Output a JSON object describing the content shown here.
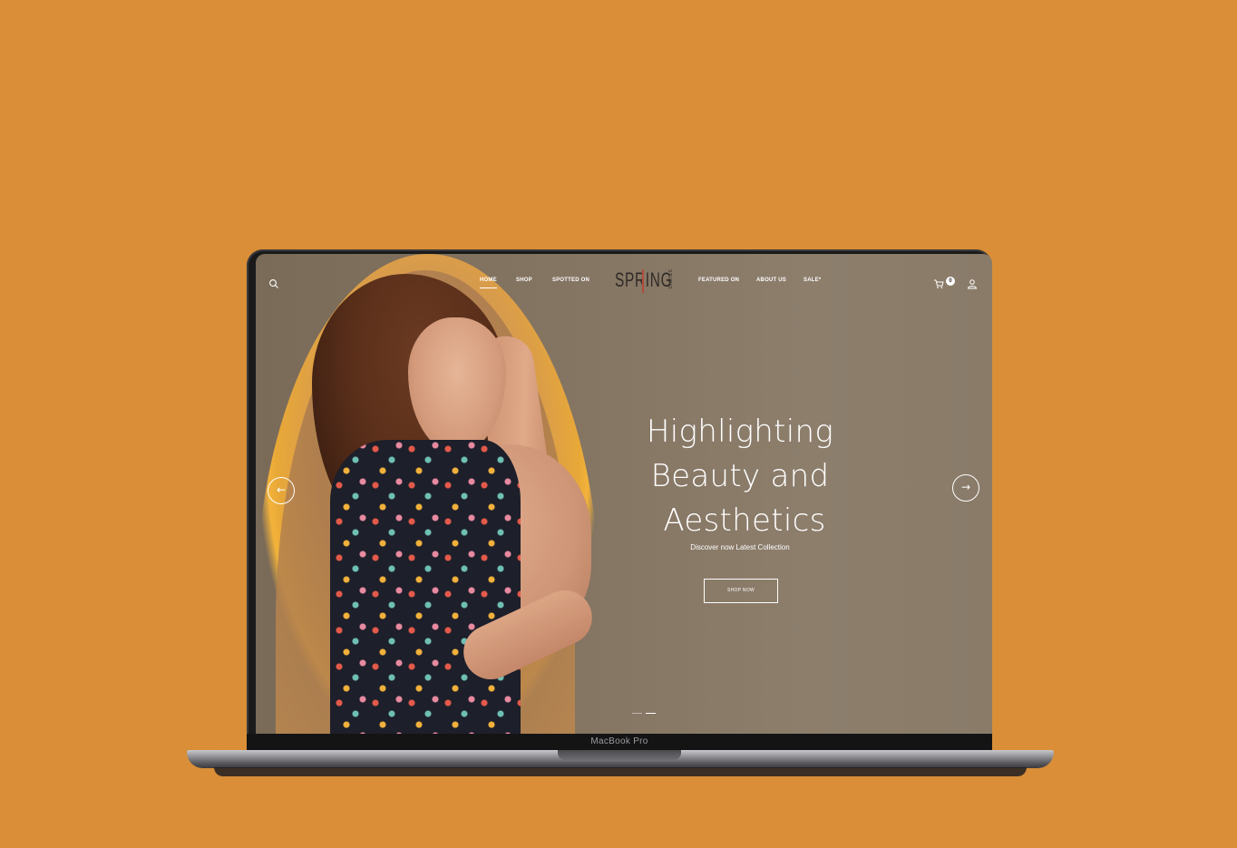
{
  "page": {
    "background_color": "#D98E37"
  },
  "device": {
    "label": "MacBook Pro"
  },
  "header": {
    "logo_text": "SPRING",
    "logo_subtext": "STUDIO",
    "nav_left": [
      {
        "label": "HOME",
        "active": true
      },
      {
        "label": "SHOP",
        "active": false
      },
      {
        "label": "SPOTTED ON",
        "active": false
      }
    ],
    "nav_right": [
      {
        "label": "FEATURED ON"
      },
      {
        "label": "ABOUT US"
      },
      {
        "label": "SALE*"
      }
    ],
    "icons": {
      "search": "search-icon",
      "cart": "cart-icon",
      "account": "user-icon"
    },
    "cart_count": "0"
  },
  "hero": {
    "title_lines": [
      "Highlighting",
      "Beauty and",
      "Aesthetics"
    ],
    "subtitle": "Discover now Latest Collection",
    "cta_label": "SHOP NOW",
    "prev_arrow": "←",
    "next_arrow": "→",
    "slides_total": 2,
    "active_slide": 2,
    "accent_color": "#F3B33A"
  }
}
